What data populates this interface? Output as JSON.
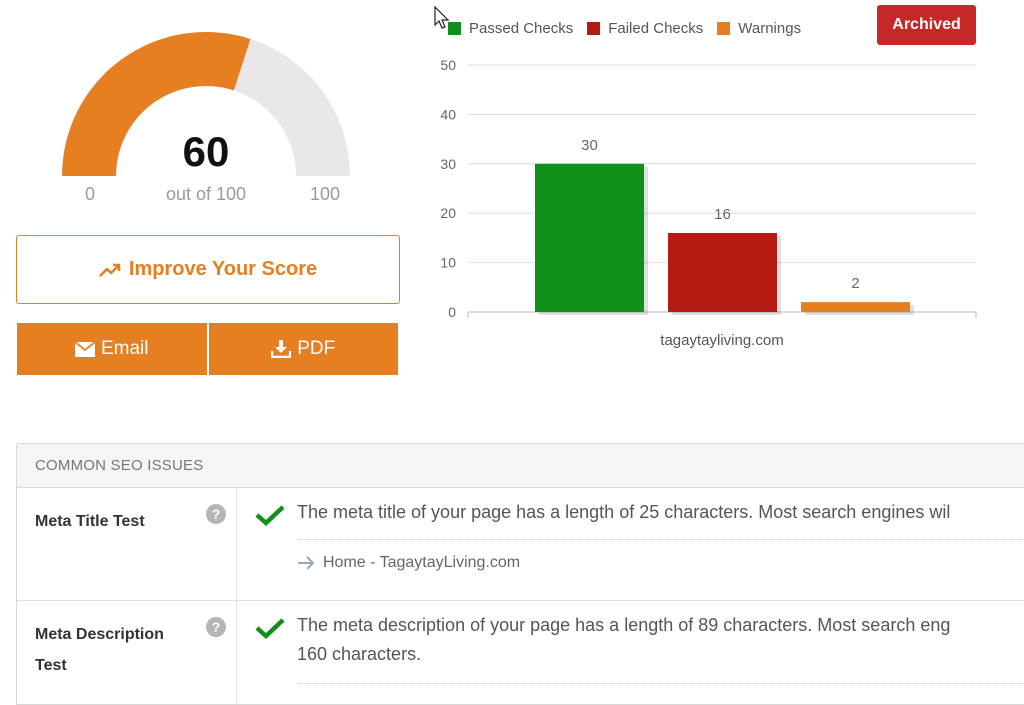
{
  "score": {
    "value": "60",
    "subtitle": "out of 100",
    "min": "0",
    "max": "100",
    "fraction": 0.6
  },
  "buttons": {
    "improve": "Improve Your Score",
    "email": "Email",
    "pdf": "PDF",
    "archived": "Archived"
  },
  "colors": {
    "orange": "#e67e22",
    "green": "#109019",
    "red": "#b71a13",
    "archived": "#c62828",
    "gauge_bg": "#e9e7e8"
  },
  "chart_data": {
    "type": "bar",
    "categories": [
      "tagaytayliving.com"
    ],
    "series": [
      {
        "name": "Passed Checks",
        "values": [
          30
        ],
        "color": "#109019"
      },
      {
        "name": "Failed Checks",
        "values": [
          16
        ],
        "color": "#b71a13"
      },
      {
        "name": "Warnings",
        "values": [
          2
        ],
        "color": "#e67e22"
      }
    ],
    "ylim": [
      0,
      50
    ],
    "yticks": [
      0,
      10,
      20,
      30,
      40,
      50
    ],
    "legend": "top-left",
    "grid": true
  },
  "issues": {
    "heading": "COMMON SEO ISSUES",
    "rows": [
      {
        "name": "Meta Title Test",
        "message": "The meta title of your page has a length of 25 characters. Most search engines wil",
        "detail": "Home - TagaytayLiving.com"
      },
      {
        "name": "Meta Description Test",
        "message": "The meta description of your page has a length of 89 characters. Most search eng",
        "message2": "160 characters."
      }
    ]
  }
}
